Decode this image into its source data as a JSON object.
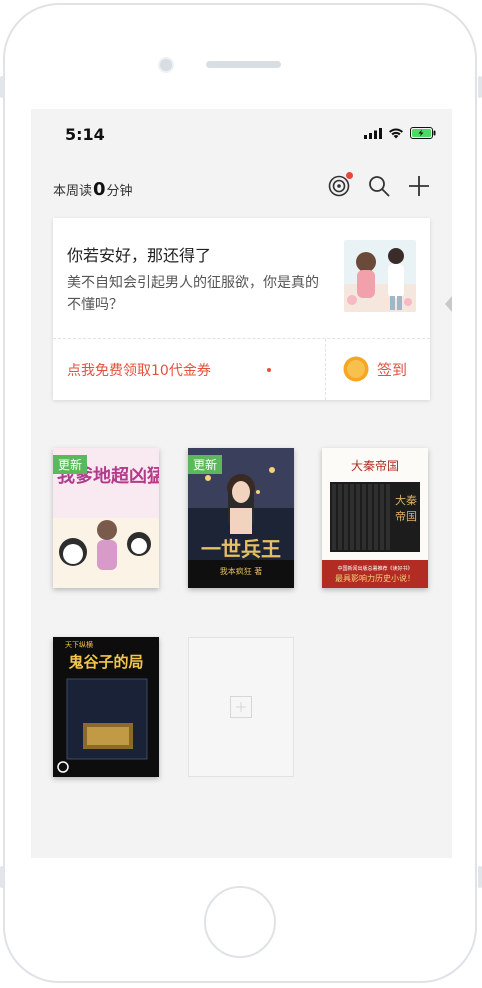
{
  "status_bar": {
    "time": "5:14"
  },
  "header": {
    "week_read_prefix": "本周读",
    "week_read_minutes": "0",
    "week_read_suffix": "分钟",
    "icons": [
      "target-icon",
      "search-icon",
      "plus-icon"
    ]
  },
  "recommend_card": {
    "title": "你若安好，那还得了",
    "description": "美不自知会引起男人的征服欲，你是真的不懂吗？",
    "coupon_link": "点我免费领取10代金券",
    "signin_label": "签到"
  },
  "bookshelf": {
    "update_badge": "更新",
    "books": [
      {
        "cover_title": "我爹地超凶猛",
        "has_update": true
      },
      {
        "cover_title": "一世兵王",
        "cover_author": "我本疯狂 著",
        "has_update": true
      },
      {
        "cover_title": "大秦帝国",
        "cover_subtitle": "中国新闻出版总署推荐《读好书》",
        "cover_tagline": "最具影响力历史小说！",
        "has_update": false
      },
      {
        "cover_title": "鬼谷子的局",
        "cover_kicker": "天下纵横",
        "has_update": false
      }
    ]
  },
  "colors": {
    "accent_red": "#e5503f",
    "update_green": "#5cb85c",
    "screen_bg": "#f3f3f3"
  }
}
